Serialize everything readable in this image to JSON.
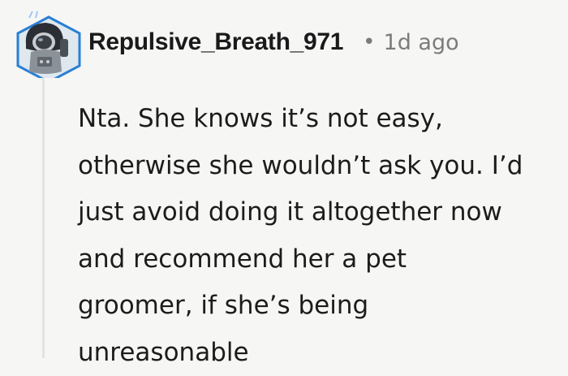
{
  "comment": {
    "username": "Repulsive_Breath_971",
    "separator": "•",
    "timestamp": "1d ago",
    "lines": [
      "Nta. She knows it’s not easy,",
      "otherwise she wouldn’t ask you. I’d",
      "just avoid doing it altogether now",
      "and recommend her a pet",
      "groomer, if she’s being",
      "unreasonable"
    ]
  },
  "colors": {
    "background": "#f6f6f5",
    "username": "#1a1a1b",
    "meta": "#7c7c7c",
    "body_text": "#1c1c1c",
    "avatar_frame": "#2a7fd4",
    "thread_line": "#e2e3e3"
  },
  "icons": {
    "avatar": "snoo-avatar-astronaut"
  }
}
